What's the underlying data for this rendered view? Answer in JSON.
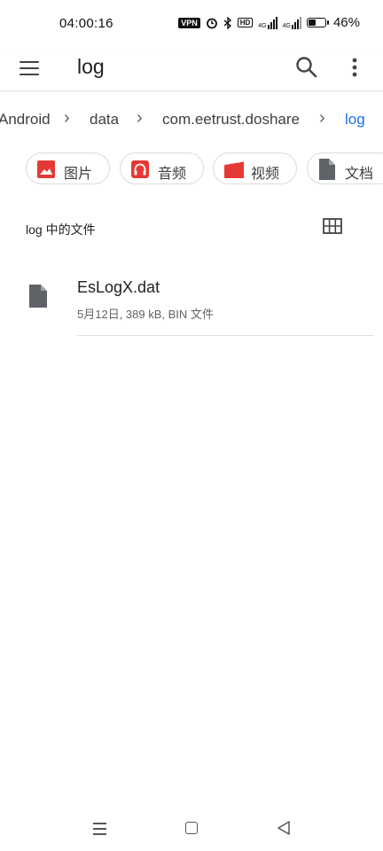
{
  "status_bar": {
    "time": "04:00:16",
    "vpn": "VPN",
    "hd": "HD",
    "network_1": "4G",
    "network_2": "4G",
    "battery_percent": "46%",
    "battery_level": 0.46
  },
  "app_bar": {
    "title": "log",
    "icons": [
      "menu-icon",
      "search-icon",
      "more-vert-icon"
    ]
  },
  "breadcrumb": {
    "items": [
      "Android",
      "data",
      "com.eetrust.doshare",
      "log"
    ],
    "active_color": "#1a73e8"
  },
  "chips": [
    {
      "label": "图片",
      "icon": "image-icon",
      "color": "#e53935"
    },
    {
      "label": "音频",
      "icon": "headphones-icon",
      "color": "#e53935"
    },
    {
      "label": "视频",
      "icon": "movie-icon",
      "color": "#e53935"
    },
    {
      "label": "文档",
      "icon": "document-icon",
      "color": "#5f6368"
    }
  ],
  "section": {
    "label": "log 中的文件",
    "view_toggle_icon": "grid-view-icon"
  },
  "files": [
    {
      "name": "EsLogX.dat",
      "meta": "5月12日, 389 kB, BIN 文件",
      "icon": "file-icon"
    }
  ],
  "nav_bar": {
    "icons": [
      "recents-icon",
      "home-icon",
      "back-icon"
    ]
  }
}
